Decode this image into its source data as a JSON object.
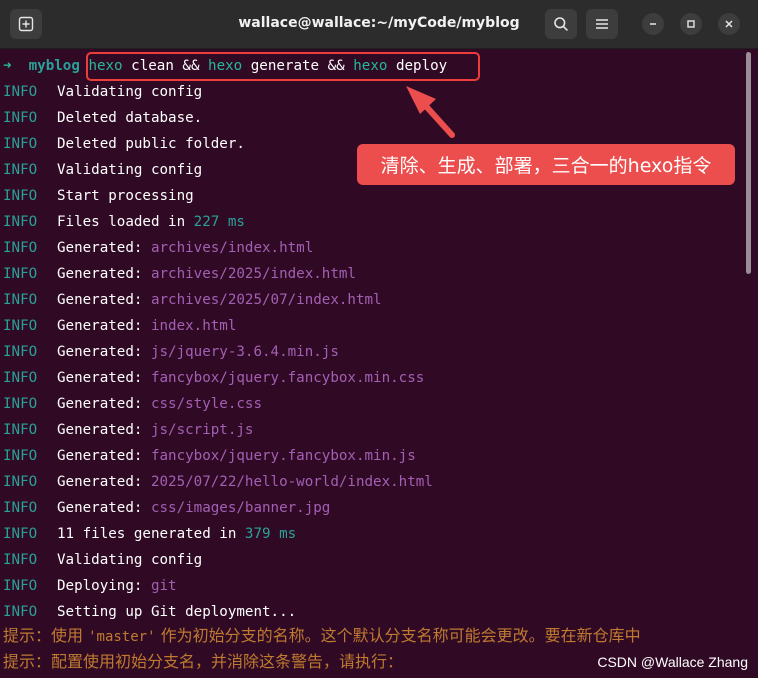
{
  "window": {
    "title": "wallace@wallace:~/myCode/myblog",
    "new_tab_icon": "new-tab-icon",
    "search_icon": "search-icon",
    "menu_icon": "hamburger-menu-icon",
    "minimize_icon": "minimize-icon",
    "maximize_icon": "maximize-icon",
    "close_icon": "close-icon"
  },
  "prompt": {
    "arrow": "➜",
    "dir": "myblog",
    "cmd1": "hexo",
    "text1": " clean && ",
    "cmd2": "hexo",
    "text2": " generate && ",
    "cmd3": "hexo",
    "text3": " deploy"
  },
  "log": [
    {
      "level": "INFO",
      "msg": "Validating config"
    },
    {
      "level": "INFO",
      "msg": "Deleted database."
    },
    {
      "level": "INFO",
      "msg": "Deleted public folder."
    },
    {
      "level": "INFO",
      "msg": "Validating config"
    },
    {
      "level": "INFO",
      "msg": "Start processing"
    },
    {
      "level": "INFO",
      "msg": "Files loaded in ",
      "num": "227 ms"
    },
    {
      "level": "INFO",
      "msg": "Generated: ",
      "path": "archives/index.html"
    },
    {
      "level": "INFO",
      "msg": "Generated: ",
      "path": "archives/2025/index.html"
    },
    {
      "level": "INFO",
      "msg": "Generated: ",
      "path": "archives/2025/07/index.html"
    },
    {
      "level": "INFO",
      "msg": "Generated: ",
      "path": "index.html"
    },
    {
      "level": "INFO",
      "msg": "Generated: ",
      "path": "js/jquery-3.6.4.min.js"
    },
    {
      "level": "INFO",
      "msg": "Generated: ",
      "path": "fancybox/jquery.fancybox.min.css"
    },
    {
      "level": "INFO",
      "msg": "Generated: ",
      "path": "css/style.css"
    },
    {
      "level": "INFO",
      "msg": "Generated: ",
      "path": "js/script.js"
    },
    {
      "level": "INFO",
      "msg": "Generated: ",
      "path": "fancybox/jquery.fancybox.min.js"
    },
    {
      "level": "INFO",
      "msg": "Generated: ",
      "path": "2025/07/22/hello-world/index.html"
    },
    {
      "level": "INFO",
      "msg": "Generated: ",
      "path": "css/images/banner.jpg"
    },
    {
      "level": "INFO",
      "msg": "11 files generated in ",
      "num": "379 ms"
    },
    {
      "level": "INFO",
      "msg": "Validating config"
    },
    {
      "level": "INFO",
      "msg": "Deploying: ",
      "path": "git"
    },
    {
      "level": "INFO",
      "msg": "Setting up Git deployment..."
    }
  ],
  "hints": {
    "line1_a": "提示：使用 ",
    "line1_q": "'master'",
    "line1_b": " 作为初始分支的名称。这个默认分支名称可能会更改。要在新仓库中",
    "line2": "提示：配置使用初始分支名，并消除这条警告，请执行："
  },
  "callout": "清除、生成、部署，三合一的hexo指令",
  "watermark": "CSDN @Wallace Zhang",
  "colors": {
    "background": "#300a24",
    "info": "#2aa198",
    "path": "#a35fb4",
    "hint": "#bf7a30",
    "annotation": "#ec4d4d"
  }
}
